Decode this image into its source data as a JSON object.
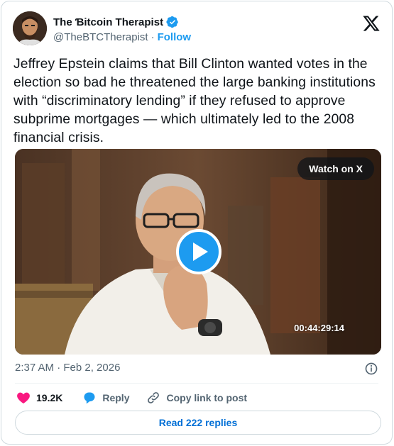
{
  "author": {
    "display_name": "The Ɓitcoin Therapist",
    "handle": "@TheBTCTherapist",
    "separator": "·",
    "follow_label": "Follow",
    "verified": true
  },
  "tweet": {
    "text": "Jeffrey Epstein claims that Bill Clinton wanted votes in the election so bad he threatened the large banking institutions with “discriminatory lending” if they refused to approve subprime mortgages — which ultimately led to the 2008 financial crisis."
  },
  "media": {
    "watch_label": "Watch on X",
    "video_timestamp": "00:44:29:14"
  },
  "meta": {
    "datetime": "2:37 AM · Feb 2, 2026"
  },
  "actions": {
    "like_count": "19.2K",
    "reply_label": "Reply",
    "copy_link_label": "Copy link to post"
  },
  "read_replies_label": "Read 222 replies",
  "colors": {
    "accent": "#1d9bf0",
    "like": "#f91880",
    "link": "#006fd6",
    "secondary_text": "#536471"
  },
  "icons": [
    "verified-badge-icon",
    "x-logo-icon",
    "play-icon",
    "info-icon",
    "heart-icon",
    "reply-bubble-icon",
    "link-icon"
  ]
}
